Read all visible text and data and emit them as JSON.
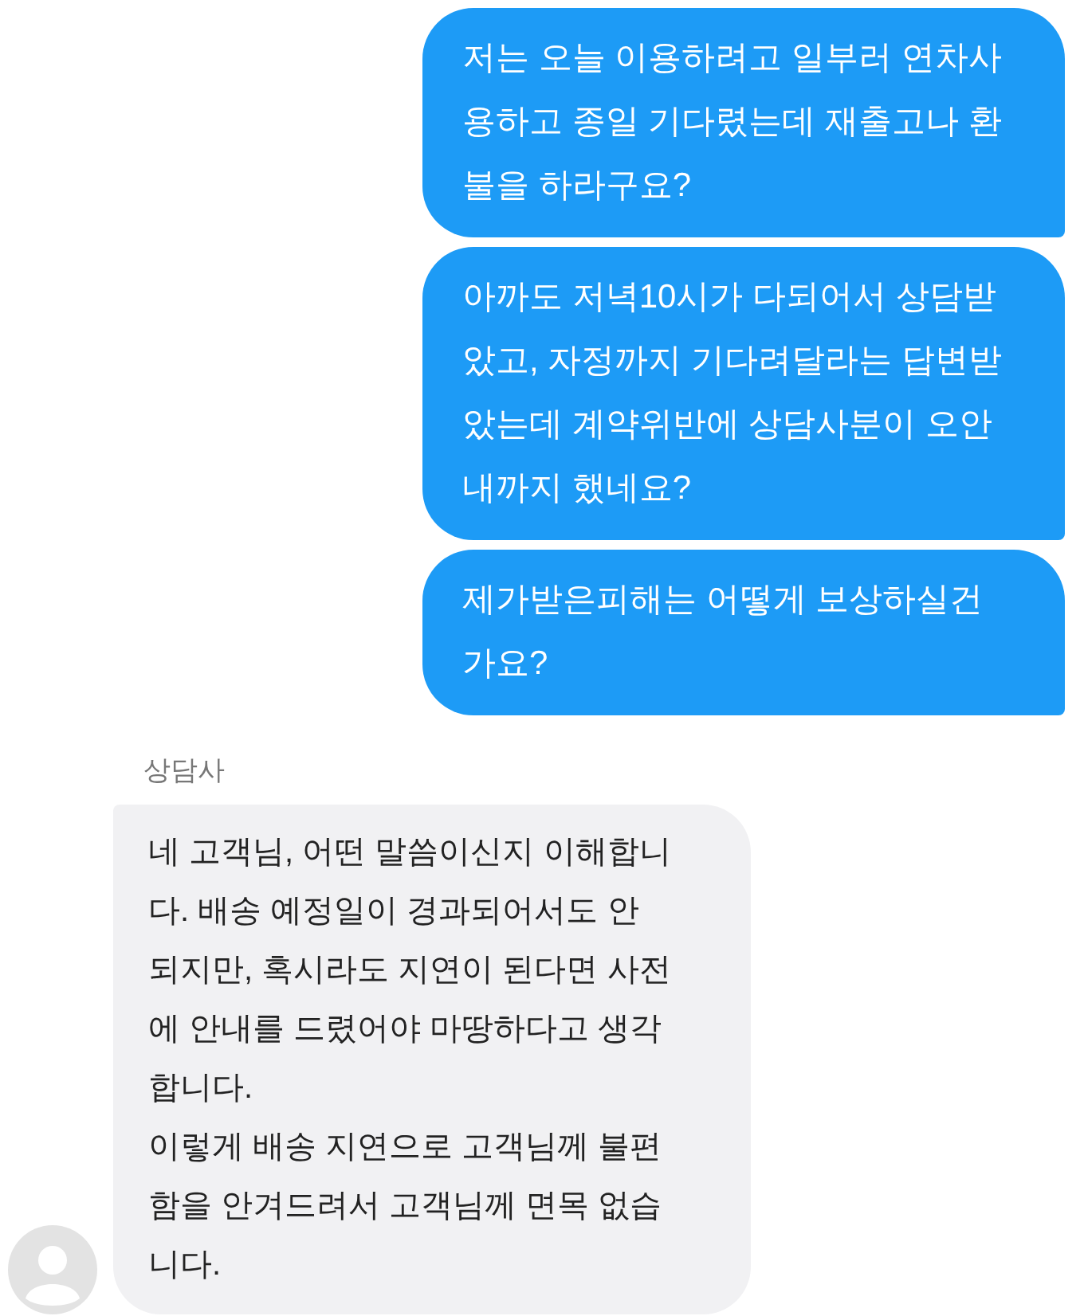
{
  "messages": [
    {
      "kind": "sent",
      "text": "저는 오늘 이용하려고 일부러 연차사\n용하고 종일 기다렸는데 재출고나 환\n불을 하라구요?"
    },
    {
      "kind": "sent",
      "text": "아까도 저녁10시가 다되어서 상담받\n았고, 자정까지 기다려달라는 답변받\n았는데 계약위반에 상담사분이 오안\n내까지 했네요?"
    },
    {
      "kind": "sent",
      "text": "제가받은피해는 어떻게 보상하실건\n가요?"
    },
    {
      "kind": "received",
      "sender": "상담사",
      "text": "네 고객님, 어떤 말씀이신지 이해합니\n다. 배송 예정일이 경과되어서도 안\n되지만, 혹시라도 지연이 된다면 사전\n에 안내를 드렸어야 마땅하다고 생각\n합니다.\n이렇게 배송 지연으로 고객님께 불편\n함을 안겨드려서 고객님께 면목 없습\n니다."
    }
  ]
}
